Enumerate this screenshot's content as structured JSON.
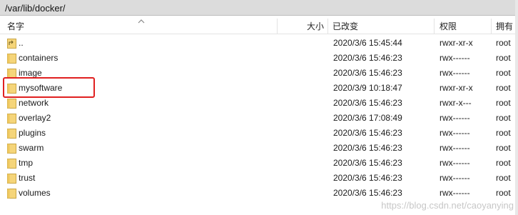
{
  "path": "/var/lib/docker/",
  "columns": {
    "name": "名字",
    "size": "大小",
    "modified": "已改变",
    "permissions": "权限",
    "owner": "拥有"
  },
  "rows": [
    {
      "name": "..",
      "modified": "2020/3/6 15:45:44",
      "permissions": "rwxr-xr-x",
      "owner": "root",
      "icon": "parent-folder-icon"
    },
    {
      "name": "containers",
      "modified": "2020/3/6 15:46:23",
      "permissions": "rwx------",
      "owner": "root",
      "icon": "folder-icon"
    },
    {
      "name": "image",
      "modified": "2020/3/6 15:46:23",
      "permissions": "rwx------",
      "owner": "root",
      "icon": "folder-icon"
    },
    {
      "name": "mysoftware",
      "modified": "2020/3/9 10:18:47",
      "permissions": "rwxr-xr-x",
      "owner": "root",
      "icon": "folder-icon"
    },
    {
      "name": "network",
      "modified": "2020/3/6 15:46:23",
      "permissions": "rwxr-x---",
      "owner": "root",
      "icon": "folder-icon"
    },
    {
      "name": "overlay2",
      "modified": "2020/3/6 17:08:49",
      "permissions": "rwx------",
      "owner": "root",
      "icon": "folder-icon"
    },
    {
      "name": "plugins",
      "modified": "2020/3/6 15:46:23",
      "permissions": "rwx------",
      "owner": "root",
      "icon": "folder-icon"
    },
    {
      "name": "swarm",
      "modified": "2020/3/6 15:46:23",
      "permissions": "rwx------",
      "owner": "root",
      "icon": "folder-icon"
    },
    {
      "name": "tmp",
      "modified": "2020/3/6 15:46:23",
      "permissions": "rwx------",
      "owner": "root",
      "icon": "folder-icon"
    },
    {
      "name": "trust",
      "modified": "2020/3/6 15:46:23",
      "permissions": "rwx------",
      "owner": "root",
      "icon": "folder-icon"
    },
    {
      "name": "volumes",
      "modified": "2020/3/6 15:46:23",
      "permissions": "rwx------",
      "owner": "root",
      "icon": "folder-icon"
    }
  ],
  "watermark": "https://blog.csdn.net/caoyanying",
  "colors": {
    "highlight": "#e02020",
    "folder": "#f5d57a"
  }
}
